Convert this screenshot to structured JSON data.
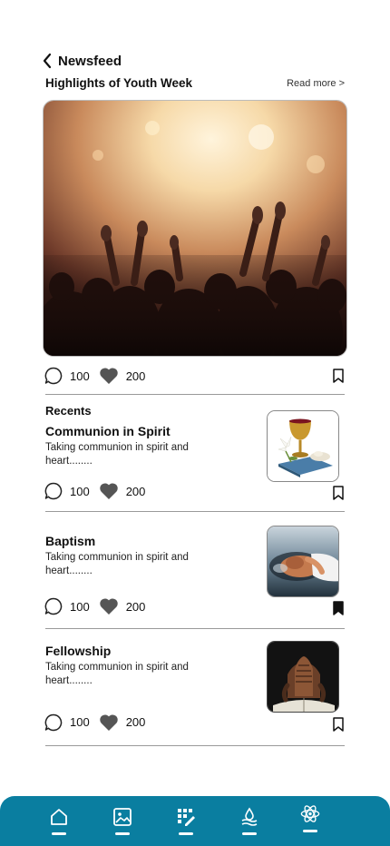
{
  "header": {
    "title": "Newsfeed"
  },
  "featured": {
    "title": "Highlights of Youth Week",
    "read_more": "Read more >",
    "comments": "100",
    "likes": "200"
  },
  "recents": {
    "label": "Recents",
    "posts": [
      {
        "title": "Communion in Spirit",
        "description": "Taking communion in spirit and heart........",
        "comments": "100",
        "likes": "200",
        "bookmarked": false
      },
      {
        "title": "Baptism",
        "description": "Taking communion in spirit and heart........",
        "comments": "100",
        "likes": "200",
        "bookmarked": true
      },
      {
        "title": "Fellowship",
        "description": "Taking communion in spirit and heart........",
        "comments": "100",
        "likes": "200",
        "bookmarked": false
      }
    ]
  },
  "nav": {
    "items": [
      "home-icon",
      "gallery-icon",
      "grid-edit-icon",
      "water-drop-icon",
      "atom-icon"
    ]
  },
  "colors": {
    "nav_background": "#0a7ea0",
    "heart": "#555555"
  }
}
